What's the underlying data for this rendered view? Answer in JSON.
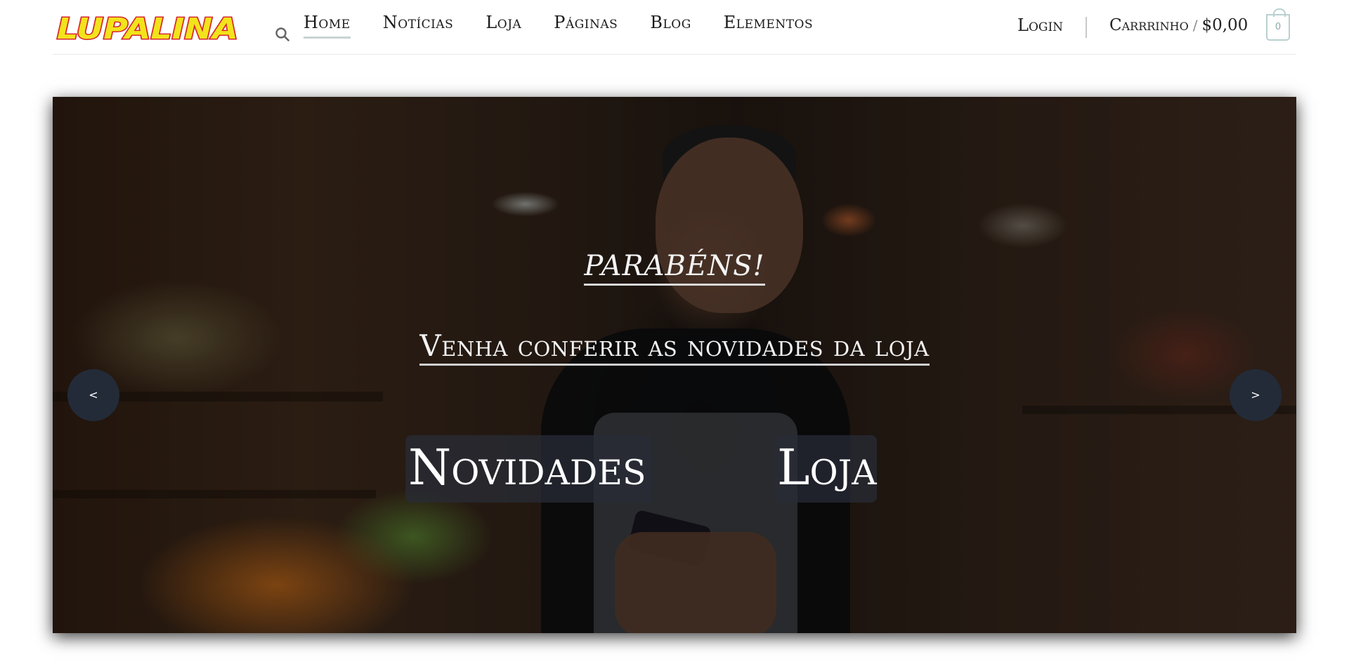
{
  "brand": {
    "logo_text": "LUPALINA",
    "logo_fill": "#f2e31b",
    "logo_outline": "#d8262a"
  },
  "nav": {
    "items": [
      {
        "label": "Home",
        "active": true
      },
      {
        "label": "Notícias",
        "active": false
      },
      {
        "label": "Loja",
        "active": false
      },
      {
        "label": "Páginas",
        "active": false
      },
      {
        "label": "Blog",
        "active": false
      },
      {
        "label": "Elementos",
        "active": false
      }
    ],
    "search_icon": "search-icon"
  },
  "account": {
    "login_label": "Login",
    "cart_label": "Carrrinho",
    "cart_separator": "/",
    "cart_total": "$0,00",
    "cart_count": "0",
    "cart_icon": "shopping-bag-icon"
  },
  "hero": {
    "subtitle": "PARABÉNS!",
    "title": "Venha conferir as novidades da loja",
    "cta_primary": "Novidades",
    "cta_secondary": "Loja",
    "prev_label": "<",
    "next_label": ">"
  },
  "colors": {
    "nav_active_underline": "#c9d3d3",
    "arrow_bg": "#232b38",
    "cta_bg": "rgba(40,45,55,0.72)"
  }
}
